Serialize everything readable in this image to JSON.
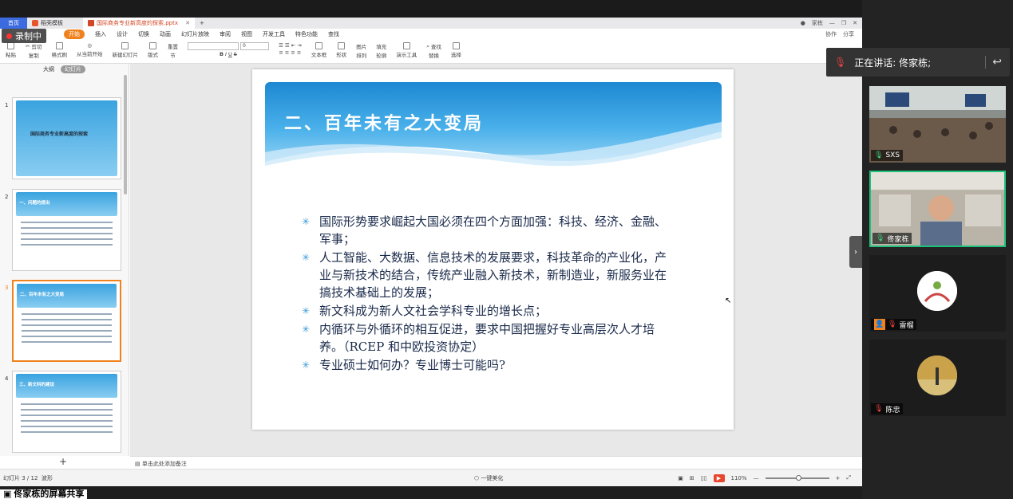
{
  "recording": {
    "label": "录制中"
  },
  "titlebar": {
    "tabs": [
      {
        "label": "首页"
      },
      {
        "label": "稻壳模板"
      },
      {
        "label": "国际商务专业新高度的探索.pptx"
      }
    ],
    "new_tab": "+",
    "user": "家栋"
  },
  "menu": {
    "items": [
      "开始",
      "插入",
      "设计",
      "切换",
      "动画",
      "幻灯片放映",
      "审阅",
      "视图",
      "开发工具",
      "特色功能",
      "查找"
    ],
    "right": [
      "协作",
      "分享"
    ]
  },
  "ribbon": {
    "paste": "粘贴",
    "cut": "剪切",
    "copy": "复制",
    "format_painter": "格式刷",
    "from_current": "从当前开始",
    "new_slide": "新建幻灯片",
    "layout": "版式",
    "section": "节",
    "reset": "重置",
    "font_size": "0",
    "textbox": "文本框",
    "shape": "形状",
    "picture": "图片",
    "arrange": "排列",
    "fill": "填充",
    "outline": "轮廓",
    "present_tools": "演示工具",
    "find": "查找",
    "replace": "替换",
    "select": "选择"
  },
  "left_panel": {
    "tab_outline": "大纲",
    "tab_slides": "幻灯片",
    "thumbs": [
      {
        "num": "1",
        "title": "国际商务专业新高度的探索"
      },
      {
        "num": "2",
        "title": "一、问题的提出"
      },
      {
        "num": "3",
        "title": "二、百年未有之大变局"
      },
      {
        "num": "4",
        "title": "三、新文科的建设"
      }
    ],
    "add": "+"
  },
  "slide": {
    "title": "二、百年未有之大变局",
    "bullets": [
      "国际形势要求崛起大国必须在四个方面加强：科技、经济、金融、军事；",
      "人工智能、大数据、信息技术的发展要求，科技革命的产业化，产业与新技术的结合，传统产业融入新技术，新制造业，新服务业在搞技术基础上的发展；",
      "新文科成为新人文社会学科专业的增长点；",
      "内循环与外循环的相互促进，要求中国把握好专业高层次人才培养。（RCEP 和中欧投资协定）",
      "专业硕士如何办？专业博士可能吗?"
    ]
  },
  "notes": {
    "placeholder": "单击此处添加备注"
  },
  "status": {
    "slide_info": "幻灯片 3 / 12",
    "theme": "波形",
    "beautify": "一键美化",
    "zoom": "110%"
  },
  "share_bar": {
    "label": "佟家栋的屏幕共享"
  },
  "speaking": {
    "label": "正在讲话: 佟家栋;"
  },
  "participants": [
    {
      "name": "SXS",
      "mic": "on"
    },
    {
      "name": "佟家栋",
      "mic": "on"
    },
    {
      "name": "雷榴",
      "mic": "muted"
    },
    {
      "name": "陈忠",
      "mic": "muted"
    }
  ]
}
